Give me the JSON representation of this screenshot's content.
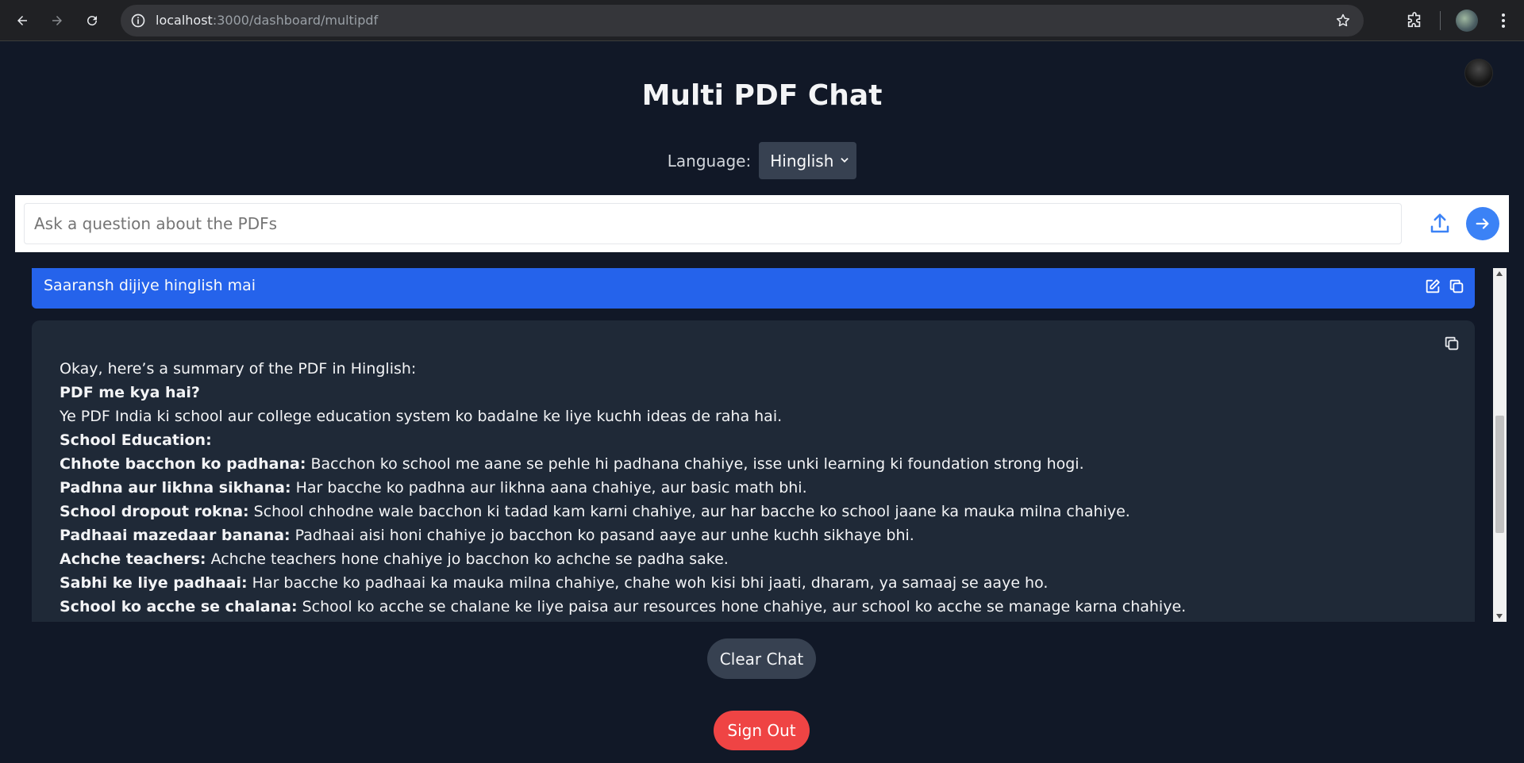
{
  "browser": {
    "url_host": "localhost",
    "url_rest": ":3000/dashboard/multipdf"
  },
  "page": {
    "title": "Multi PDF Chat",
    "language_label": "Language:",
    "language_value": "Hinglish"
  },
  "ask": {
    "placeholder": "Ask a question about the PDFs"
  },
  "chat": {
    "user_message": "Saaransh dijiye hinglish mai",
    "bot_lines": [
      {
        "bold": "",
        "text": "Okay, here’s a summary of the PDF in Hinglish:"
      },
      {
        "bold": "PDF me kya hai?",
        "text": ""
      },
      {
        "bold": "",
        "text": "Ye PDF India ki school aur college education system ko badalne ke liye kuchh ideas de raha hai."
      },
      {
        "bold": "School Education:",
        "text": ""
      },
      {
        "bold": "Chhote bacchon ko padhana:",
        "text": " Bacchon ko school me aane se pehle hi padhana chahiye, isse unki learning ki foundation strong hogi."
      },
      {
        "bold": "Padhna aur likhna sikhana:",
        "text": " Har bacche ko padhna aur likhna aana chahiye, aur basic math bhi."
      },
      {
        "bold": "School dropout rokna:",
        "text": " School chhodne wale bacchon ki tadad kam karni chahiye, aur har bacche ko school jaane ka mauka milna chahiye."
      },
      {
        "bold": "Padhaai mazedaar banana:",
        "text": " Padhaai aisi honi chahiye jo bacchon ko pasand aaye aur unhe kuchh sikhaye bhi."
      },
      {
        "bold": "Achche teachers:",
        "text": " Achche teachers hone chahiye jo bacchon ko achche se padha sake."
      },
      {
        "bold": "Sabhi ke liye padhaai:",
        "text": " Har bacche ko padhaai ka mauka milna chahiye, chahe woh kisi bhi jaati, dharam, ya samaaj se aaye ho."
      },
      {
        "bold": "School ko acche se chalana:",
        "text": " School ko acche se chalane ke liye paisa aur resources hone chahiye, aur school ko acche se manage karna chahiye."
      }
    ]
  },
  "buttons": {
    "clear_chat": "Clear Chat",
    "sign_out": "Sign Out"
  },
  "colors": {
    "background": "#111827",
    "user_bubble": "#2563eb",
    "bot_bubble": "#1f2937",
    "send_button": "#3b82f6",
    "sign_out": "#ef4444"
  }
}
